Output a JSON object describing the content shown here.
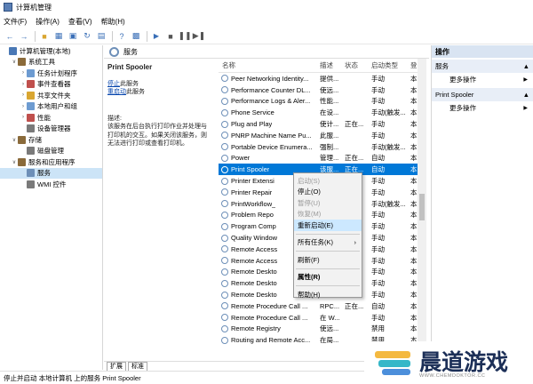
{
  "window": {
    "title": "计算机管理"
  },
  "menu": [
    "文件(F)",
    "操作(A)",
    "查看(V)",
    "帮助(H)"
  ],
  "tree": [
    {
      "label": "计算机管理(本地)",
      "level": 0,
      "twisty": "",
      "color": "#4a78b5"
    },
    {
      "label": "系统工具",
      "level": 1,
      "twisty": "v",
      "color": "#8a6a3a"
    },
    {
      "label": "任务计划程序",
      "level": 2,
      "twisty": ">",
      "color": "#6d9bd1"
    },
    {
      "label": "事件查看器",
      "level": 2,
      "twisty": ">",
      "color": "#c0504d"
    },
    {
      "label": "共享文件夹",
      "level": 2,
      "twisty": ">",
      "color": "#d9a631"
    },
    {
      "label": "本地用户和组",
      "level": 2,
      "twisty": ">",
      "color": "#6d9bd1"
    },
    {
      "label": "性能",
      "level": 2,
      "twisty": ">",
      "color": "#c0504d"
    },
    {
      "label": "设备管理器",
      "level": 2,
      "twisty": "",
      "color": "#7a7a7a"
    },
    {
      "label": "存储",
      "level": 1,
      "twisty": "v",
      "color": "#8a6a3a"
    },
    {
      "label": "磁盘管理",
      "level": 2,
      "twisty": "",
      "color": "#7a7a7a"
    },
    {
      "label": "服务和应用程序",
      "level": 1,
      "twisty": "v",
      "color": "#8a6a3a"
    },
    {
      "label": "服务",
      "level": 2,
      "twisty": "",
      "color": "#6d8fb8",
      "selected": true
    },
    {
      "label": "WMI 控件",
      "level": 2,
      "twisty": "",
      "color": "#7a7a7a"
    }
  ],
  "services_header": "服务",
  "description": {
    "title": "Print Spooler",
    "stop_link": "停止",
    "stop_suffix": "此服务",
    "restart_link": "重启动",
    "restart_suffix": "此服务",
    "desc_label": "描述:",
    "desc_lines": [
      "该服务在后台执行打印作业并处理与",
      "打印机的交互。如果关闭该服务，则",
      "无法进行打印或查看打印机。"
    ]
  },
  "columns": {
    "name": "名称",
    "desc": "描述",
    "status": "状态",
    "start": "启动类型",
    "logon": "登"
  },
  "rows": [
    {
      "name": "Peer Networking Identity...",
      "desc": "提供...",
      "status": "",
      "start": "手动",
      "logon": "本"
    },
    {
      "name": "Performance Counter DL...",
      "desc": "使远...",
      "status": "",
      "start": "手动",
      "logon": "本"
    },
    {
      "name": "Performance Logs & Aler...",
      "desc": "性能...",
      "status": "",
      "start": "手动",
      "logon": "本"
    },
    {
      "name": "Phone Service",
      "desc": "在设...",
      "status": "",
      "start": "手动(触发...",
      "logon": "本"
    },
    {
      "name": "Plug and Play",
      "desc": "使计...",
      "status": "正在...",
      "start": "手动",
      "logon": "本"
    },
    {
      "name": "PNRP Machine Name Pu...",
      "desc": "此服...",
      "status": "",
      "start": "手动",
      "logon": "本"
    },
    {
      "name": "Portable Device Enumera...",
      "desc": "强制...",
      "status": "",
      "start": "手动(触发...",
      "logon": "本"
    },
    {
      "name": "Power",
      "desc": "管理...",
      "status": "正在...",
      "start": "自动",
      "logon": "本"
    },
    {
      "name": "Print Spooler",
      "desc": "该服...",
      "status": "正在...",
      "start": "自动",
      "logon": "本",
      "selected": true
    },
    {
      "name": "Printer Extensi",
      "desc": "",
      "status": "",
      "start": "手动",
      "logon": "本"
    },
    {
      "name": "Printer Repair",
      "desc": "",
      "status": "",
      "start": "手动",
      "logon": "本"
    },
    {
      "name": "PrintWorkflow_",
      "desc": "",
      "status": "",
      "start": "手动(触发...",
      "logon": "本"
    },
    {
      "name": "Problem Repo",
      "desc": "",
      "status": "",
      "start": "手动",
      "logon": "本"
    },
    {
      "name": "Program Comp",
      "desc": "",
      "status": "",
      "start": "手动",
      "logon": "本"
    },
    {
      "name": "Quality Window",
      "desc": "",
      "status": "",
      "start": "手动",
      "logon": "本"
    },
    {
      "name": "Remote Access",
      "desc": "",
      "status": "",
      "start": "手动",
      "logon": "本"
    },
    {
      "name": "Remote Access",
      "desc": "",
      "status": "",
      "start": "手动",
      "logon": "本"
    },
    {
      "name": "Remote Deskto",
      "desc": "",
      "status": "",
      "start": "手动",
      "logon": "本"
    },
    {
      "name": "Remote Deskto",
      "desc": "",
      "status": "",
      "start": "手动",
      "logon": "本"
    },
    {
      "name": "Remote Deskto",
      "desc": "",
      "status": "",
      "start": "手动",
      "logon": "本"
    },
    {
      "name": "Remote Procedure Call ...",
      "desc": "RPC...",
      "status": "正在...",
      "start": "自动",
      "logon": "本"
    },
    {
      "name": "Remote Procedure Call ...",
      "desc": "在 W...",
      "status": "",
      "start": "手动",
      "logon": "本"
    },
    {
      "name": "Remote Registry",
      "desc": "使远...",
      "status": "",
      "start": "禁用",
      "logon": "本"
    },
    {
      "name": "Routing and Remote Acc...",
      "desc": "在局...",
      "status": "",
      "start": "禁用",
      "logon": "本"
    }
  ],
  "tabs": [
    "扩展",
    "标准"
  ],
  "actions": {
    "title": "操作",
    "sections": [
      {
        "label": "服务",
        "item": "更多操作"
      },
      {
        "label": "Print Spooler",
        "item": "更多操作"
      }
    ]
  },
  "context_menu": [
    {
      "label": "启动(S)",
      "disabled": true
    },
    {
      "label": "停止(O)"
    },
    {
      "label": "暂停(U)",
      "disabled": true
    },
    {
      "label": "恢复(M)",
      "disabled": true
    },
    {
      "label": "重新启动(E)",
      "hover": true
    },
    {
      "sep": true
    },
    {
      "label": "所有任务(K)",
      "submenu": true
    },
    {
      "sep": true
    },
    {
      "label": "刷新(F)"
    },
    {
      "sep": true
    },
    {
      "label": "属性(R)",
      "bold": true
    },
    {
      "sep": true
    },
    {
      "label": "帮助(H)"
    }
  ],
  "status_bar": "停止并启动 本地计算机 上的服务 Print Spooler",
  "brand": {
    "name": "晨道游戏",
    "sub": "WWW.CHEMDOKTOR.CC"
  }
}
